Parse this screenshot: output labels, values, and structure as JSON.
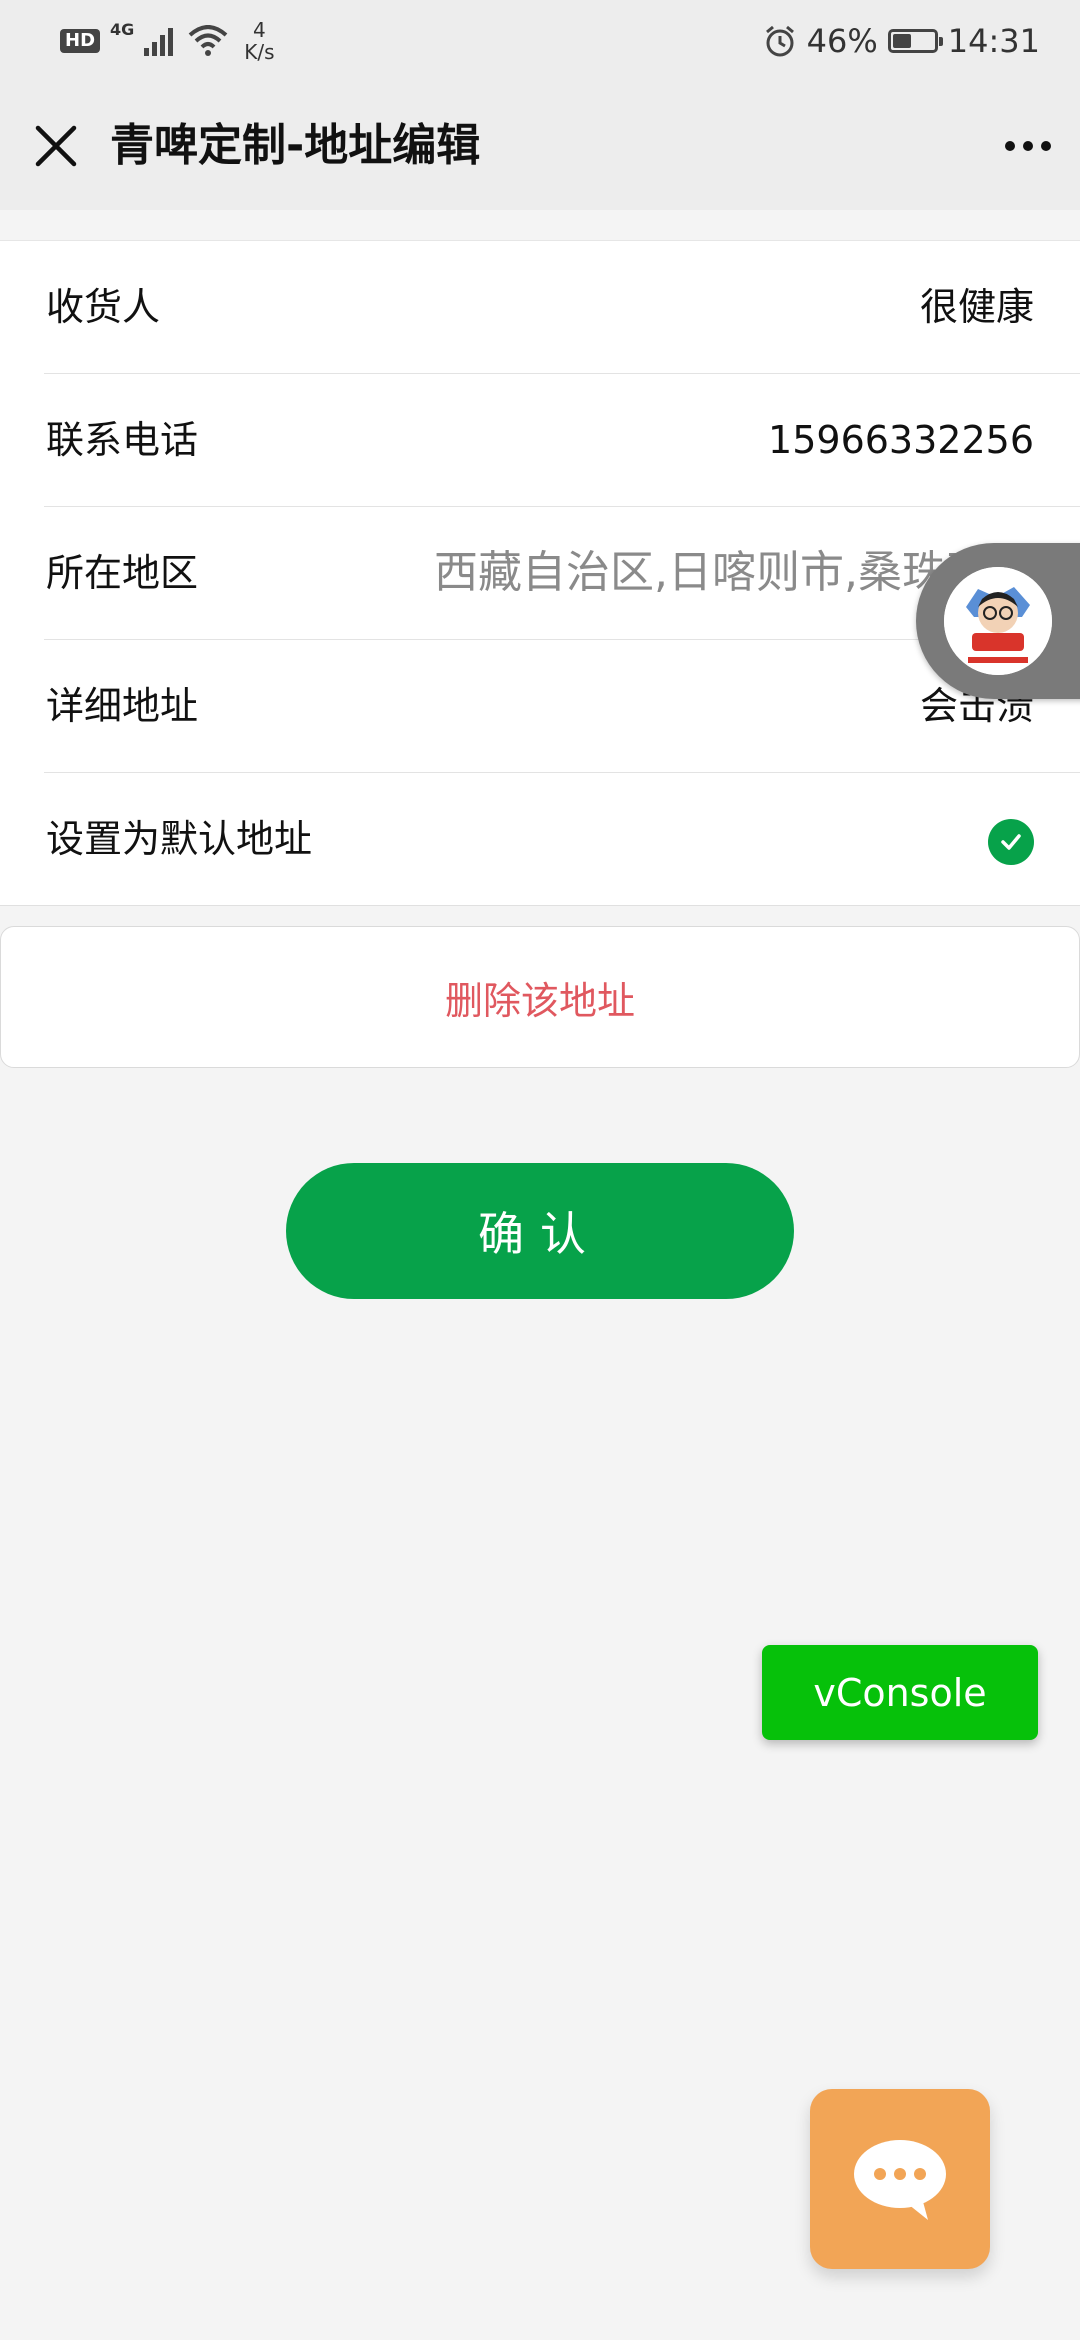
{
  "status_bar": {
    "hd": "HD",
    "network": "4G",
    "speed_value": "4",
    "speed_unit": "K/s",
    "battery_percent": "46%",
    "battery_level": 0.46,
    "time": "14:31"
  },
  "navbar": {
    "title": "青啤定制-地址编辑"
  },
  "form": {
    "rows": [
      {
        "label": "收货人",
        "value": "很健康"
      },
      {
        "label": "联系电话",
        "value": "15966332256"
      },
      {
        "label": "所在地区",
        "value": "西藏自治区,日喀则市,桑珠孜区"
      },
      {
        "label": "详细地址",
        "value": "会击溃"
      },
      {
        "label": "设置为默认地址",
        "checked": true
      }
    ]
  },
  "actions": {
    "delete_label": "删除该地址",
    "confirm_label": "确认"
  },
  "floating": {
    "vconsole_label": "vConsole"
  },
  "colors": {
    "primary_green": "#07a24a",
    "delete_red": "#e0585f",
    "vconsole_green": "#06c10a",
    "chat_orange": "#f2a556"
  }
}
